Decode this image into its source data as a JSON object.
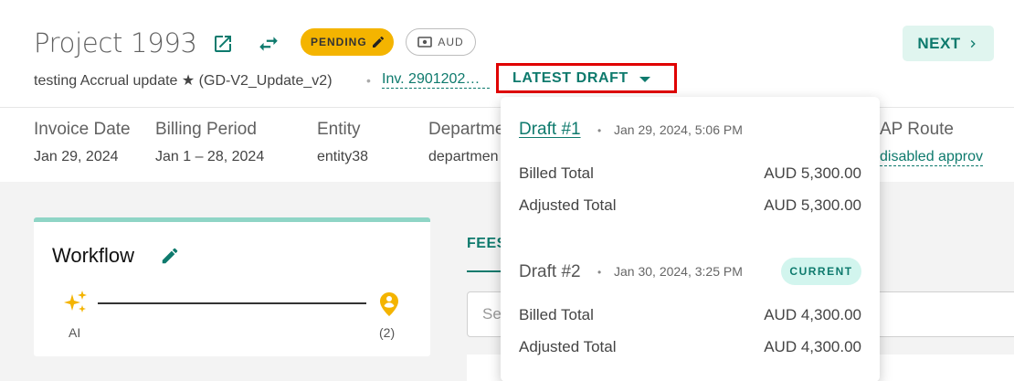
{
  "header": {
    "title": "Project 1993",
    "status_badge": "PENDING",
    "currency_chip": "AUD",
    "next_label": "NEXT",
    "subtitle": "testing Accrual update ★ (GD-V2_Update_v2)",
    "separator": "•",
    "invoice_link": "Inv. 2901202…",
    "latest_draft_label": "LATEST DRAFT"
  },
  "meta": [
    {
      "label": "Invoice Date",
      "value": "Jan 29, 2024"
    },
    {
      "label": "Billing Period",
      "value": "Jan 1 – 28, 2024"
    },
    {
      "label": "Entity",
      "value": "entity38"
    },
    {
      "label": "Department",
      "value": "departmen"
    },
    {
      "label": "AP Route",
      "value": "disabled approv"
    }
  ],
  "workflow": {
    "title": "Workflow",
    "start_label": "AI",
    "end_label": "(2)"
  },
  "fees": {
    "tab_label": "FEES",
    "search_placeholder": "Se"
  },
  "drafts": [
    {
      "name": "Draft #1",
      "date": "Jan 29, 2024, 5:06 PM",
      "billed_label": "Billed Total",
      "billed_value": "AUD 5,300.00",
      "adjusted_label": "Adjusted Total",
      "adjusted_value": "AUD 5,300.00"
    },
    {
      "name": "Draft #2",
      "date": "Jan 30, 2024, 3:25 PM",
      "badge": "CURRENT",
      "billed_label": "Billed Total",
      "billed_value": "AUD 4,300.00",
      "adjusted_label": "Adjusted Total",
      "adjusted_value": "AUD 4,300.00"
    }
  ],
  "colors": {
    "accent": "#0e7a6d",
    "pending": "#f4b400",
    "highlight_border": "#e00000",
    "workflow_bar": "#8fd5c6"
  }
}
